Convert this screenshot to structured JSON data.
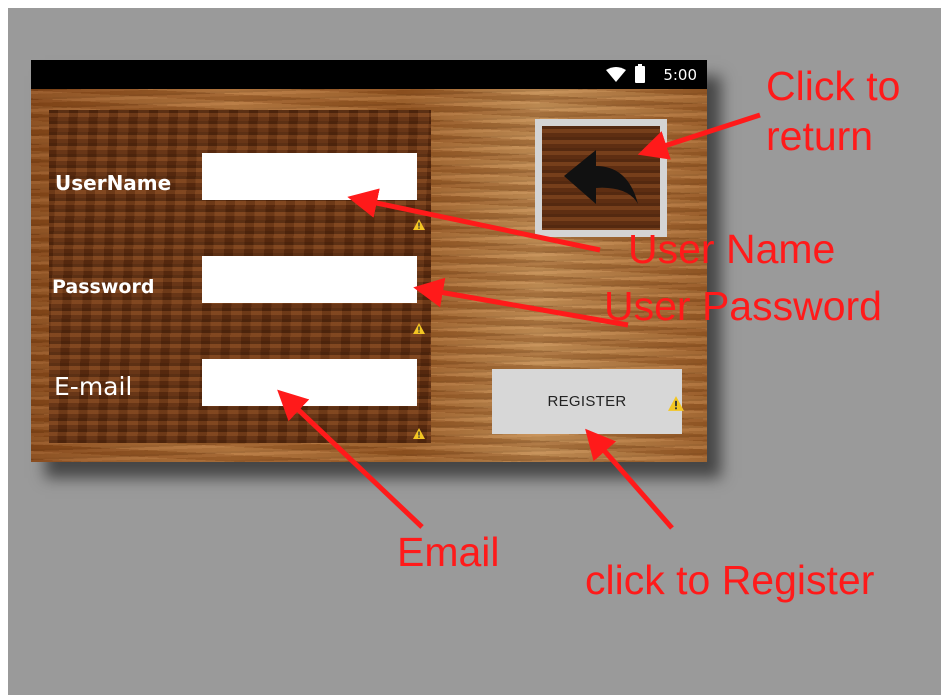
{
  "status_bar": {
    "time": "5:00",
    "wifi_icon": "wifi-icon",
    "battery_icon": "battery-icon"
  },
  "form": {
    "username": {
      "label": "UserName",
      "value": ""
    },
    "password": {
      "label": "Password",
      "value": ""
    },
    "email": {
      "label": "E-mail",
      "value": ""
    }
  },
  "back_button": {
    "icon": "back-arrow-icon"
  },
  "register_button": {
    "label": "REGISTER"
  },
  "annotations": {
    "return_line1": "Click to",
    "return_line2": "return",
    "user_name": "User Name",
    "user_password": "User Password",
    "email": "Email",
    "register": "click to Register"
  },
  "colors": {
    "annotation": "#ff1a1a",
    "background": "#9a9a9a",
    "wood": "#9a5a26",
    "warning": "#f3c623"
  }
}
